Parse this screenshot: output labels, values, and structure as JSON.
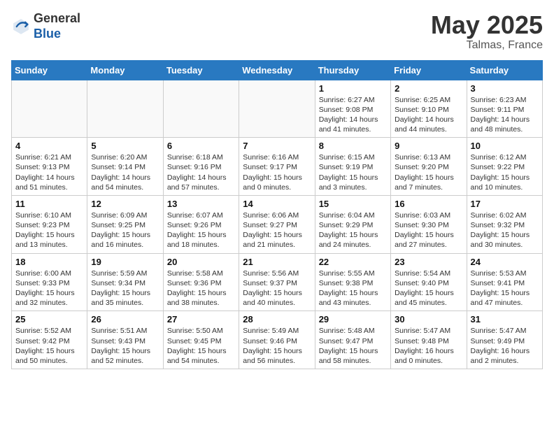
{
  "header": {
    "logo_general": "General",
    "logo_blue": "Blue",
    "main_title": "May 2025",
    "subtitle": "Talmas, France"
  },
  "calendar": {
    "days_of_week": [
      "Sunday",
      "Monday",
      "Tuesday",
      "Wednesday",
      "Thursday",
      "Friday",
      "Saturday"
    ],
    "weeks": [
      [
        {
          "day": "",
          "info": ""
        },
        {
          "day": "",
          "info": ""
        },
        {
          "day": "",
          "info": ""
        },
        {
          "day": "",
          "info": ""
        },
        {
          "day": "1",
          "info": "Sunrise: 6:27 AM\nSunset: 9:08 PM\nDaylight: 14 hours and 41 minutes."
        },
        {
          "day": "2",
          "info": "Sunrise: 6:25 AM\nSunset: 9:10 PM\nDaylight: 14 hours and 44 minutes."
        },
        {
          "day": "3",
          "info": "Sunrise: 6:23 AM\nSunset: 9:11 PM\nDaylight: 14 hours and 48 minutes."
        }
      ],
      [
        {
          "day": "4",
          "info": "Sunrise: 6:21 AM\nSunset: 9:13 PM\nDaylight: 14 hours and 51 minutes."
        },
        {
          "day": "5",
          "info": "Sunrise: 6:20 AM\nSunset: 9:14 PM\nDaylight: 14 hours and 54 minutes."
        },
        {
          "day": "6",
          "info": "Sunrise: 6:18 AM\nSunset: 9:16 PM\nDaylight: 14 hours and 57 minutes."
        },
        {
          "day": "7",
          "info": "Sunrise: 6:16 AM\nSunset: 9:17 PM\nDaylight: 15 hours and 0 minutes."
        },
        {
          "day": "8",
          "info": "Sunrise: 6:15 AM\nSunset: 9:19 PM\nDaylight: 15 hours and 3 minutes."
        },
        {
          "day": "9",
          "info": "Sunrise: 6:13 AM\nSunset: 9:20 PM\nDaylight: 15 hours and 7 minutes."
        },
        {
          "day": "10",
          "info": "Sunrise: 6:12 AM\nSunset: 9:22 PM\nDaylight: 15 hours and 10 minutes."
        }
      ],
      [
        {
          "day": "11",
          "info": "Sunrise: 6:10 AM\nSunset: 9:23 PM\nDaylight: 15 hours and 13 minutes."
        },
        {
          "day": "12",
          "info": "Sunrise: 6:09 AM\nSunset: 9:25 PM\nDaylight: 15 hours and 16 minutes."
        },
        {
          "day": "13",
          "info": "Sunrise: 6:07 AM\nSunset: 9:26 PM\nDaylight: 15 hours and 18 minutes."
        },
        {
          "day": "14",
          "info": "Sunrise: 6:06 AM\nSunset: 9:27 PM\nDaylight: 15 hours and 21 minutes."
        },
        {
          "day": "15",
          "info": "Sunrise: 6:04 AM\nSunset: 9:29 PM\nDaylight: 15 hours and 24 minutes."
        },
        {
          "day": "16",
          "info": "Sunrise: 6:03 AM\nSunset: 9:30 PM\nDaylight: 15 hours and 27 minutes."
        },
        {
          "day": "17",
          "info": "Sunrise: 6:02 AM\nSunset: 9:32 PM\nDaylight: 15 hours and 30 minutes."
        }
      ],
      [
        {
          "day": "18",
          "info": "Sunrise: 6:00 AM\nSunset: 9:33 PM\nDaylight: 15 hours and 32 minutes."
        },
        {
          "day": "19",
          "info": "Sunrise: 5:59 AM\nSunset: 9:34 PM\nDaylight: 15 hours and 35 minutes."
        },
        {
          "day": "20",
          "info": "Sunrise: 5:58 AM\nSunset: 9:36 PM\nDaylight: 15 hours and 38 minutes."
        },
        {
          "day": "21",
          "info": "Sunrise: 5:56 AM\nSunset: 9:37 PM\nDaylight: 15 hours and 40 minutes."
        },
        {
          "day": "22",
          "info": "Sunrise: 5:55 AM\nSunset: 9:38 PM\nDaylight: 15 hours and 43 minutes."
        },
        {
          "day": "23",
          "info": "Sunrise: 5:54 AM\nSunset: 9:40 PM\nDaylight: 15 hours and 45 minutes."
        },
        {
          "day": "24",
          "info": "Sunrise: 5:53 AM\nSunset: 9:41 PM\nDaylight: 15 hours and 47 minutes."
        }
      ],
      [
        {
          "day": "25",
          "info": "Sunrise: 5:52 AM\nSunset: 9:42 PM\nDaylight: 15 hours and 50 minutes."
        },
        {
          "day": "26",
          "info": "Sunrise: 5:51 AM\nSunset: 9:43 PM\nDaylight: 15 hours and 52 minutes."
        },
        {
          "day": "27",
          "info": "Sunrise: 5:50 AM\nSunset: 9:45 PM\nDaylight: 15 hours and 54 minutes."
        },
        {
          "day": "28",
          "info": "Sunrise: 5:49 AM\nSunset: 9:46 PM\nDaylight: 15 hours and 56 minutes."
        },
        {
          "day": "29",
          "info": "Sunrise: 5:48 AM\nSunset: 9:47 PM\nDaylight: 15 hours and 58 minutes."
        },
        {
          "day": "30",
          "info": "Sunrise: 5:47 AM\nSunset: 9:48 PM\nDaylight: 16 hours and 0 minutes."
        },
        {
          "day": "31",
          "info": "Sunrise: 5:47 AM\nSunset: 9:49 PM\nDaylight: 16 hours and 2 minutes."
        }
      ]
    ]
  }
}
